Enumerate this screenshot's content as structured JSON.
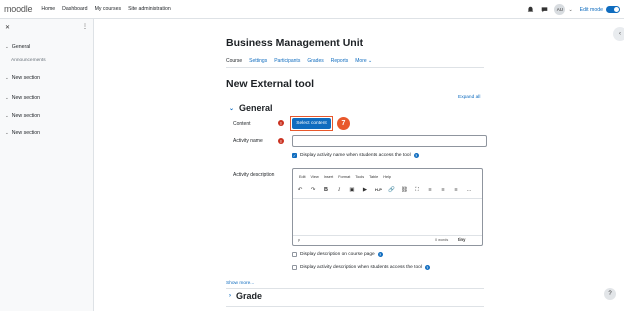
{
  "navbar": {
    "logo": "moodle",
    "links": [
      "Home",
      "Dashboard",
      "My courses",
      "Site administration"
    ],
    "avatar_initials": "AU",
    "edit_mode_label": "Edit mode",
    "edit_mode_on": true
  },
  "drawer": {
    "items": [
      {
        "label": "General",
        "expanded": true,
        "children": [
          "Announcements"
        ]
      },
      {
        "label": "New section",
        "expanded": false
      },
      {
        "label": "New section",
        "expanded": false
      },
      {
        "label": "New section",
        "expanded": false
      },
      {
        "label": "New section",
        "expanded": false
      }
    ]
  },
  "course": {
    "title": "Business Management Unit",
    "tabs": [
      "Course",
      "Settings",
      "Participants",
      "Grades",
      "Reports",
      "More ⌄"
    ],
    "active_tab": "Course"
  },
  "form": {
    "page_title": "New External tool",
    "expand_all": "Expand all",
    "section_general": "General",
    "content_label": "Content",
    "select_content_button": "Select content",
    "step_number": "7",
    "activity_name_label": "Activity name",
    "activity_name_value": "",
    "display_name_checkbox": "Display activity name when students access the tool",
    "display_name_checked": true,
    "activity_description_label": "Activity description",
    "editor_menu": [
      "Edit",
      "View",
      "Insert",
      "Format",
      "Tools",
      "Table",
      "Help"
    ],
    "editor_path": "p",
    "editor_word_count": "0 words",
    "editor_brand": "tiny",
    "display_desc_course_page": "Display description on course page",
    "display_desc_access_tool": "Display activity description when students access the tool",
    "show_more": "Show more...",
    "section_grade": "Grade"
  },
  "icons": {
    "accent": "#0f6cbf",
    "required": "#ca3120",
    "highlight": "#e8582c"
  }
}
